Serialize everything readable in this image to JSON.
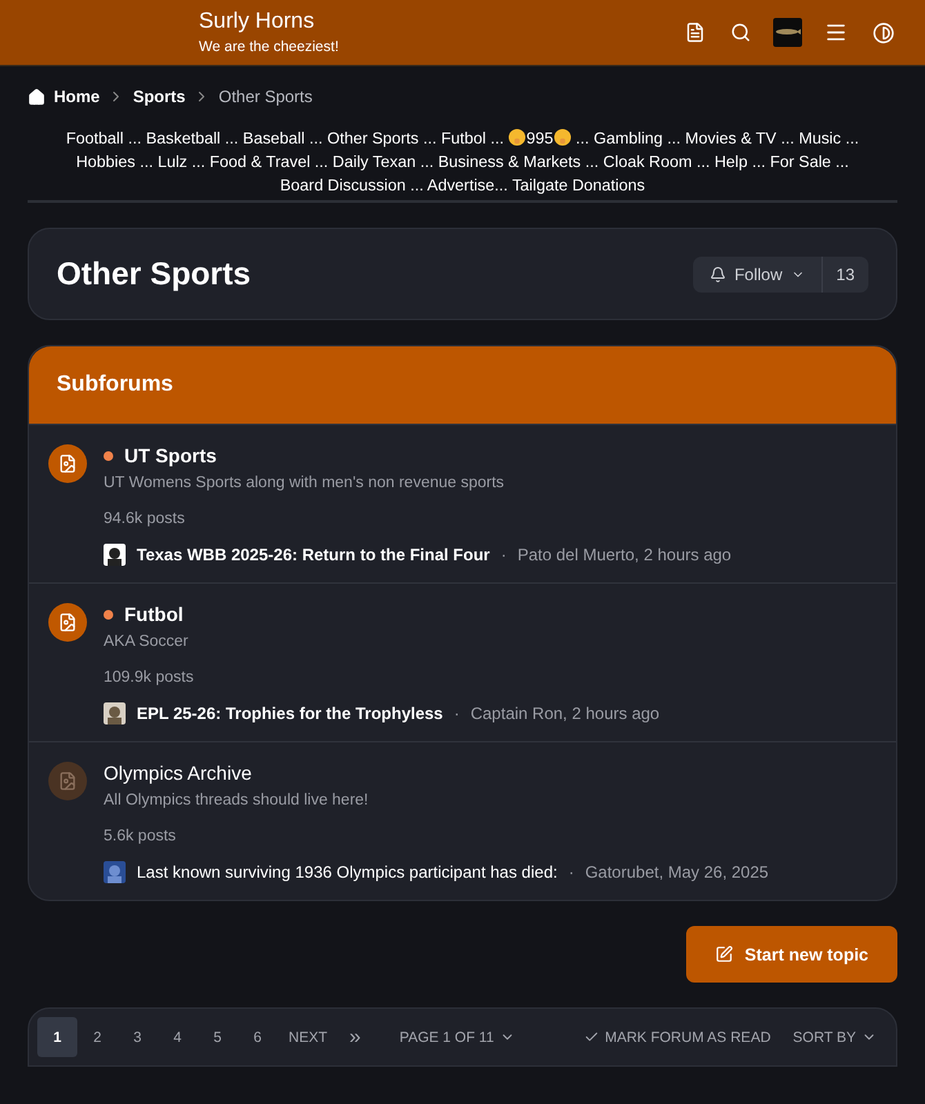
{
  "header": {
    "title": "Surly Horns",
    "tagline": "We are the cheeziest!"
  },
  "breadcrumb": [
    {
      "label": "Home",
      "kind": "home",
      "current": false
    },
    {
      "label": "Sports",
      "kind": "link",
      "current": false
    },
    {
      "label": "Other Sports",
      "kind": "link",
      "current": true
    }
  ],
  "nav": [
    {
      "label": "Football",
      "sep": " ... "
    },
    {
      "label": "Basketball",
      "sep": " ... "
    },
    {
      "label": "Baseball",
      "sep": " ... "
    },
    {
      "label": "Other Sports",
      "sep": " ... "
    },
    {
      "label": "Futbol",
      "sep": " ... "
    },
    {
      "label": "995",
      "kind": "emoji",
      "sep": " ... "
    },
    {
      "label": "Gambling",
      "sep": " ... "
    },
    {
      "label": "Movies & TV",
      "sep": " ... "
    },
    {
      "label": "Music",
      "sep": " ... "
    },
    {
      "label": "Hobbies",
      "sep": " ... "
    },
    {
      "label": "Lulz",
      "sep": " ... "
    },
    {
      "label": "Food & Travel",
      "sep": " ... "
    },
    {
      "label": "Daily Texan",
      "sep": " ... "
    },
    {
      "label": "Business & Markets",
      "sep": " ... "
    },
    {
      "label": "Cloak Room",
      "sep": " ... "
    },
    {
      "label": "Help",
      "sep": " ... "
    },
    {
      "label": "For Sale",
      "sep": " ... "
    },
    {
      "label": "Board Discussion",
      "sep": " ... "
    },
    {
      "label": "Advertise",
      "sep": "... "
    },
    {
      "label": "Tailgate Donations"
    }
  ],
  "page_title": "Other Sports",
  "follow": {
    "label": "Follow",
    "count": "13"
  },
  "subforums": {
    "title": "Subforums",
    "items": [
      {
        "title": "UT Sports",
        "unread": true,
        "description": "UT Womens Sports along with men's non revenue sports",
        "posts": "94.6k posts",
        "last_title": "Texas WBB 2025-26: Return to the Final Four",
        "meta_sep": "·",
        "last_meta": "Pato del Muerto, 2 hours ago"
      },
      {
        "title": "Futbol",
        "unread": true,
        "description": "AKA Soccer",
        "posts": "109.9k posts",
        "last_title": "EPL 25-26: Trophies for the Trophyless",
        "meta_sep": "·",
        "last_meta": "Captain Ron, 2 hours ago"
      },
      {
        "title": "Olympics Archive",
        "unread": false,
        "description": "All Olympics threads should live here!",
        "posts": "5.6k posts",
        "last_title": "Last known surviving 1936 Olympics participant has died:",
        "meta_sep": "·",
        "last_meta": "Gatorubet, May 26, 2025"
      }
    ]
  },
  "new_topic": "Start new topic",
  "pagination": {
    "pages": [
      {
        "label": "1",
        "selected": true
      },
      {
        "label": "2",
        "selected": false
      },
      {
        "label": "3",
        "selected": false
      },
      {
        "label": "4",
        "selected": false
      },
      {
        "label": "5",
        "selected": false
      },
      {
        "label": "6",
        "selected": false
      }
    ],
    "next": "NEXT",
    "last": "»",
    "page_of": "PAGE 1 OF 11",
    "mark_read": "MARK FORUM AS READ",
    "sort": "SORT BY"
  }
}
